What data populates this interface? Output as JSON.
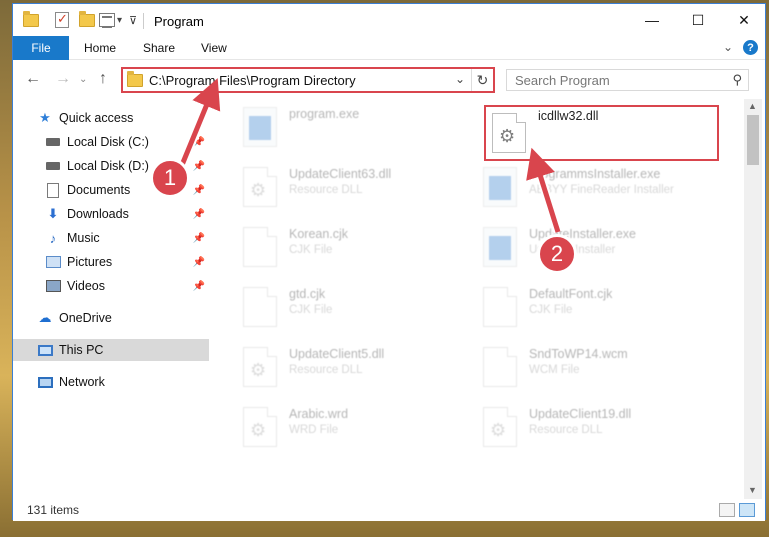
{
  "window": {
    "title": "Program",
    "controls": {
      "minimize": "—",
      "maximize": "☐",
      "close": "✕"
    }
  },
  "ribbon": {
    "file": "File",
    "tabs": [
      "Home",
      "Share",
      "View"
    ],
    "expand": "⌄",
    "help": "?"
  },
  "nav": {
    "back": "←",
    "forward": "→",
    "up": "↑",
    "address": "C:\\Program Files\\Program Directory",
    "dropdown": "⌄",
    "refresh": "↻",
    "search_placeholder": "Search Program",
    "search_icon": "⚲"
  },
  "sidebar": {
    "items": [
      {
        "label": "Quick access",
        "icon": "star-icon",
        "pinned": false
      },
      {
        "label": "Local Disk (C:)",
        "icon": "disk-icon",
        "pinned": true
      },
      {
        "label": "Local Disk (D:)",
        "icon": "disk-icon",
        "pinned": true
      },
      {
        "label": "Documents",
        "icon": "document-icon",
        "pinned": true
      },
      {
        "label": "Downloads",
        "icon": "download-icon",
        "pinned": true
      },
      {
        "label": "Music",
        "icon": "music-icon",
        "pinned": true
      },
      {
        "label": "Pictures",
        "icon": "pictures-icon",
        "pinned": true
      },
      {
        "label": "Videos",
        "icon": "videos-icon",
        "pinned": true
      },
      {
        "label": "OneDrive",
        "icon": "cloud-icon",
        "pinned": false
      },
      {
        "label": "This PC",
        "icon": "computer-icon",
        "pinned": false,
        "selected": true
      },
      {
        "label": "Network",
        "icon": "network-icon",
        "pinned": false
      }
    ]
  },
  "files": [
    {
      "name": "program.exe",
      "type": "",
      "icon": "exe-icon",
      "faded": true
    },
    {
      "name": "icdllw32.dll",
      "type": "",
      "icon": "gear-file-icon",
      "faded": false,
      "highlighted": true
    },
    {
      "name": "UpdateClient63.dll",
      "type": "Resource DLL",
      "icon": "gear-file-icon",
      "faded": true
    },
    {
      "name": "ProgrammsInstaller.exe",
      "type": "ABBYY FineReader Installer",
      "icon": "installer-icon",
      "faded": true
    },
    {
      "name": "Korean.cjk",
      "type": "CJK File",
      "icon": "file-icon",
      "faded": true
    },
    {
      "name": "UpdateInstaller.exe",
      "type": "Updates Installer",
      "icon": "installer-icon",
      "faded": true
    },
    {
      "name": "gtd.cjk",
      "type": "CJK File",
      "icon": "file-icon",
      "faded": true
    },
    {
      "name": "DefaultFont.cjk",
      "type": "CJK File",
      "icon": "file-icon",
      "faded": true
    },
    {
      "name": "UpdateClient5.dll",
      "type": "Resource DLL",
      "icon": "gear-file-icon",
      "faded": true
    },
    {
      "name": "SndToWP14.wcm",
      "type": "WCM File",
      "icon": "file-icon",
      "faded": true
    },
    {
      "name": "Arabic.wrd",
      "type": "WRD File",
      "icon": "gear-file-icon",
      "faded": true
    },
    {
      "name": "UpdateClient19.dll",
      "type": "Resource DLL",
      "icon": "gear-file-icon",
      "faded": true
    }
  ],
  "status": {
    "count": "131 items"
  },
  "annotations": {
    "step1": "1",
    "step2": "2",
    "color": "#d9454d"
  }
}
